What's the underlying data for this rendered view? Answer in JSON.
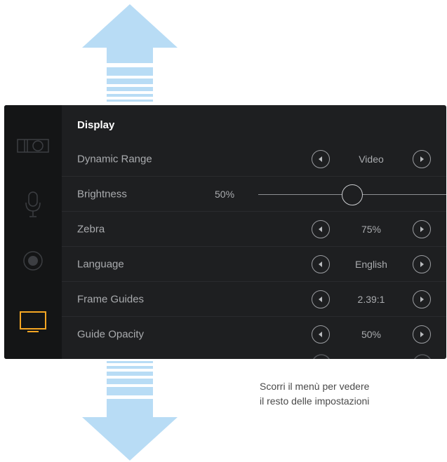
{
  "menu": {
    "title": "Display",
    "rows": [
      {
        "label": "Dynamic Range",
        "value": "Video"
      },
      {
        "label": "Brightness",
        "value": "50%",
        "level_percent": 50
      },
      {
        "label": "Zebra",
        "value": "75%"
      },
      {
        "label": "Language",
        "value": "English"
      },
      {
        "label": "Frame Guides",
        "value": "2.39:1"
      },
      {
        "label": "Guide Opacity",
        "value": "50%"
      }
    ]
  },
  "sidebar": {
    "tabs": [
      {
        "icon": "camera-icon",
        "active": false
      },
      {
        "icon": "microphone-icon",
        "active": false
      },
      {
        "icon": "record-icon",
        "active": false
      },
      {
        "icon": "monitor-icon",
        "active": true
      }
    ]
  },
  "hint": {
    "line1": "Scorri il menù per vedere",
    "line2": "il resto delle impostazioni"
  },
  "colors": {
    "arrow": "#b8dcf5",
    "panel": "#1e1f21",
    "sidebar": "#141516",
    "accent": "#f5a623",
    "text": "#a9abae"
  }
}
